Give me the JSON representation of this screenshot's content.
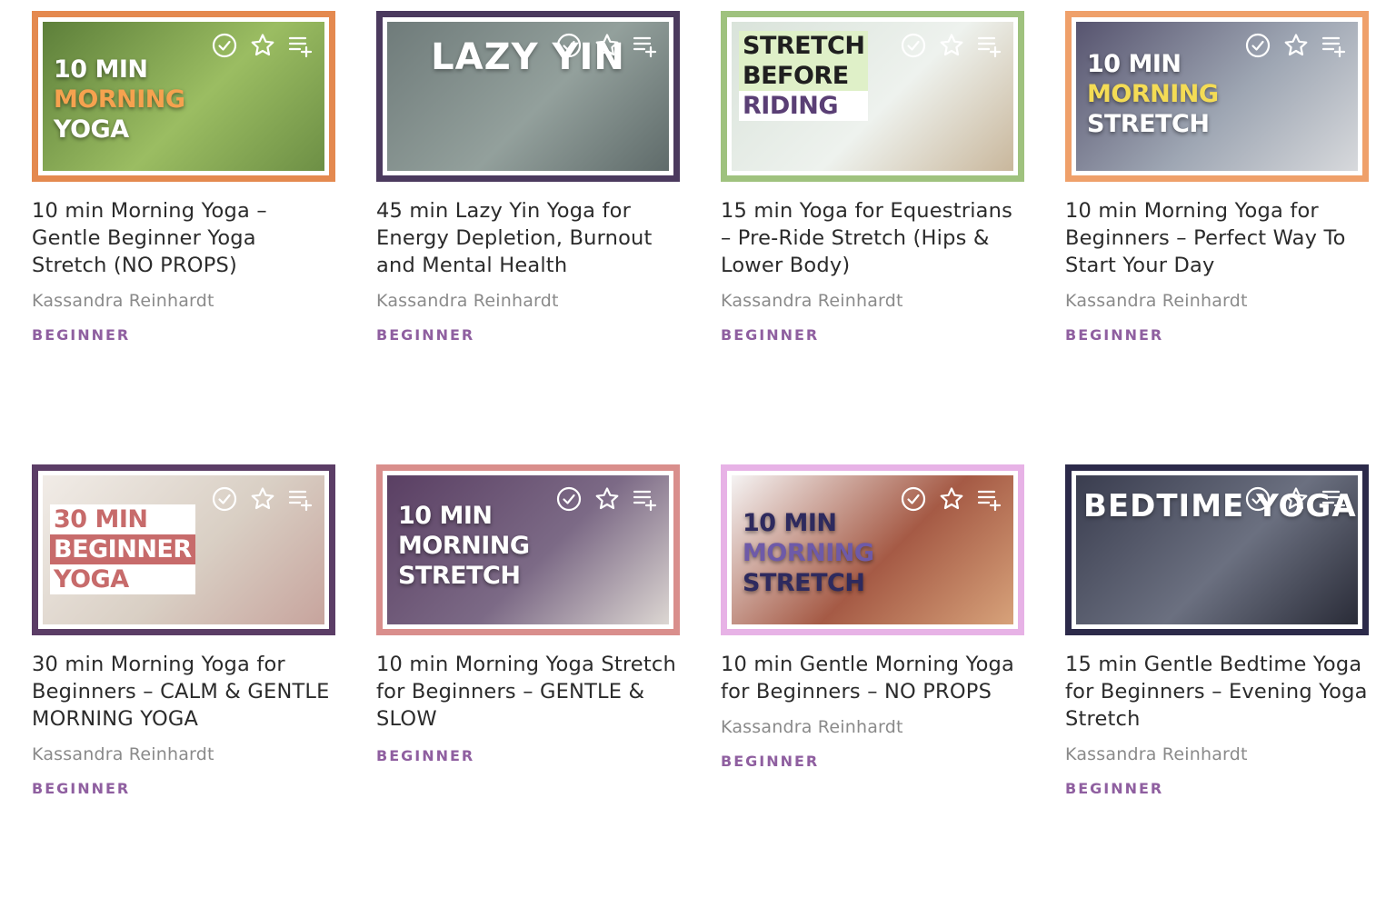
{
  "icons": {
    "complete": "check-circle-icon",
    "favorite": "star-icon",
    "add_to_playlist": "playlist-add-icon"
  },
  "colors": {
    "level_text": "#8f5fa0",
    "author_text": "#8a8a8a",
    "title_text": "#2b2b2b"
  },
  "videos": [
    {
      "title": "10 min Morning Yoga – Gentle Beginner Yoga Stretch (NO PROPS)",
      "author": "Kassandra Reinhardt",
      "level": "BEGINNER",
      "thumb_lines": [
        "10 MIN",
        "MORNING",
        "YOGA"
      ],
      "frame_color": "#e4894f",
      "bg_colors": [
        "#5d7f3a",
        "#9bbd62",
        "#6d8f45"
      ]
    },
    {
      "title": "45 min Lazy Yin Yoga for Energy Depletion, Burnout and Mental Health",
      "author": "Kassandra Reinhardt",
      "level": "BEGINNER",
      "thumb_lines": [
        "LAZY YIN"
      ],
      "frame_color": "#4b3a5e",
      "bg_colors": [
        "#6f7b7a",
        "#93a09c",
        "#5f6b6a"
      ]
    },
    {
      "title": "15 min Yoga for Equestrians – Pre-Ride Stretch (Hips & Lower Body)",
      "author": "Kassandra Reinhardt",
      "level": "BEGINNER",
      "thumb_lines": [
        "STRETCH",
        "BEFORE",
        "RIDING"
      ],
      "frame_color": "#9fc27e",
      "bg_colors": [
        "#d9e3da",
        "#eef2ee",
        "#c9b79c"
      ]
    },
    {
      "title": "10 min Morning Yoga for Beginners – Perfect Way To Start Your Day",
      "author": "Kassandra Reinhardt",
      "level": "BEGINNER",
      "thumb_lines": [
        "10 MIN",
        "MORNING",
        "STRETCH"
      ],
      "frame_color": "#efa06a",
      "bg_colors": [
        "#57546f",
        "#9ea6b3",
        "#d7d9dc"
      ]
    },
    {
      "title": "30 min Morning Yoga for Beginners – CALM & GENTLE MORNING YOGA",
      "author": "Kassandra Reinhardt",
      "level": "BEGINNER",
      "thumb_lines": [
        "30 MIN",
        "BEGINNER",
        "YOGA"
      ],
      "frame_color": "#5b3d66",
      "bg_colors": [
        "#f1ece7",
        "#d9cfc4",
        "#c7a49d"
      ]
    },
    {
      "title": "10 min Morning Yoga Stretch for Beginners – GENTLE & SLOW",
      "author": "",
      "level": "BEGINNER",
      "thumb_lines": [
        "10 MIN",
        "MORNING",
        "STRETCH"
      ],
      "frame_color": "#d98e8c",
      "bg_colors": [
        "#5a3f63",
        "#7c6a86",
        "#dcd6d2"
      ]
    },
    {
      "title": "10 min Gentle Morning Yoga for Beginners – NO PROPS",
      "author": "Kassandra Reinhardt",
      "level": "BEGINNER",
      "thumb_lines": [
        "10 MIN",
        "MORNING",
        "STRETCH"
      ],
      "frame_color": "#e7b2e6",
      "bg_colors": [
        "#f5f3f3",
        "#a55a45",
        "#d7a27a"
      ]
    },
    {
      "title": "15 min Gentle Bedtime Yoga for Beginners – Evening Yoga Stretch",
      "author": "Kassandra Reinhardt",
      "level": "BEGINNER",
      "thumb_lines": [
        "BEDTIME YOGA"
      ],
      "frame_color": "#2c2a4a",
      "bg_colors": [
        "#3a3d4f",
        "#6b7080",
        "#2a2c38"
      ]
    }
  ]
}
